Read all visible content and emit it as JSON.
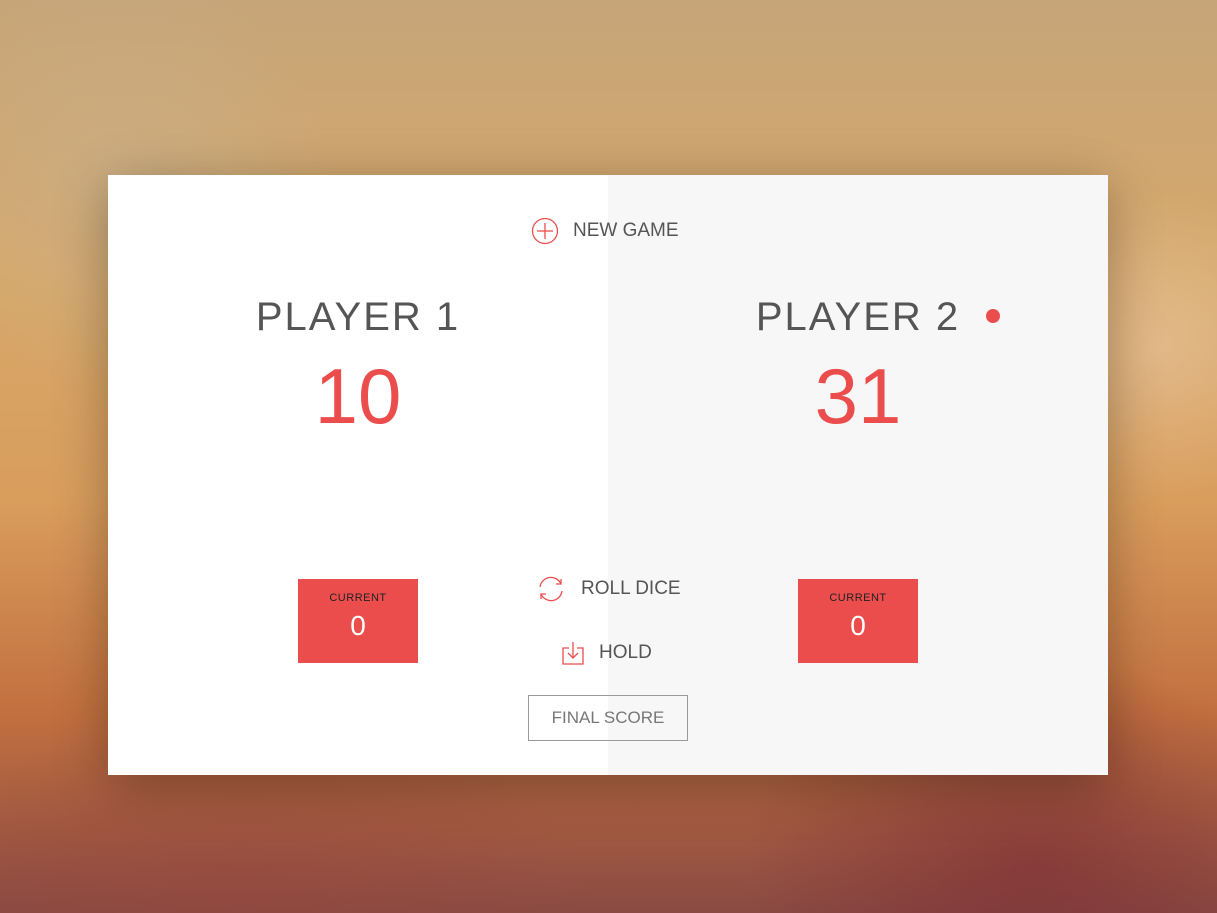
{
  "controls": {
    "new_game_label": "New game",
    "roll_dice_label": "Roll dice",
    "hold_label": "Hold",
    "final_score_placeholder": "Final score",
    "final_score_value": ""
  },
  "players": [
    {
      "name": "Player 1",
      "score": "10",
      "current_label": "Current",
      "current_score": "0",
      "active": false
    },
    {
      "name": "Player 2",
      "score": "31",
      "current_label": "Current",
      "current_score": "0",
      "active": true
    }
  ],
  "colors": {
    "accent": "#EB4D4D",
    "text": "#555555",
    "panel_active_bg": "#F7F7F7",
    "panel_bg": "#FFFFFF"
  },
  "icons": {
    "new_game": "circle-plus-icon",
    "roll_dice": "refresh-icon",
    "hold": "download-icon",
    "active_player": "dot-icon"
  }
}
